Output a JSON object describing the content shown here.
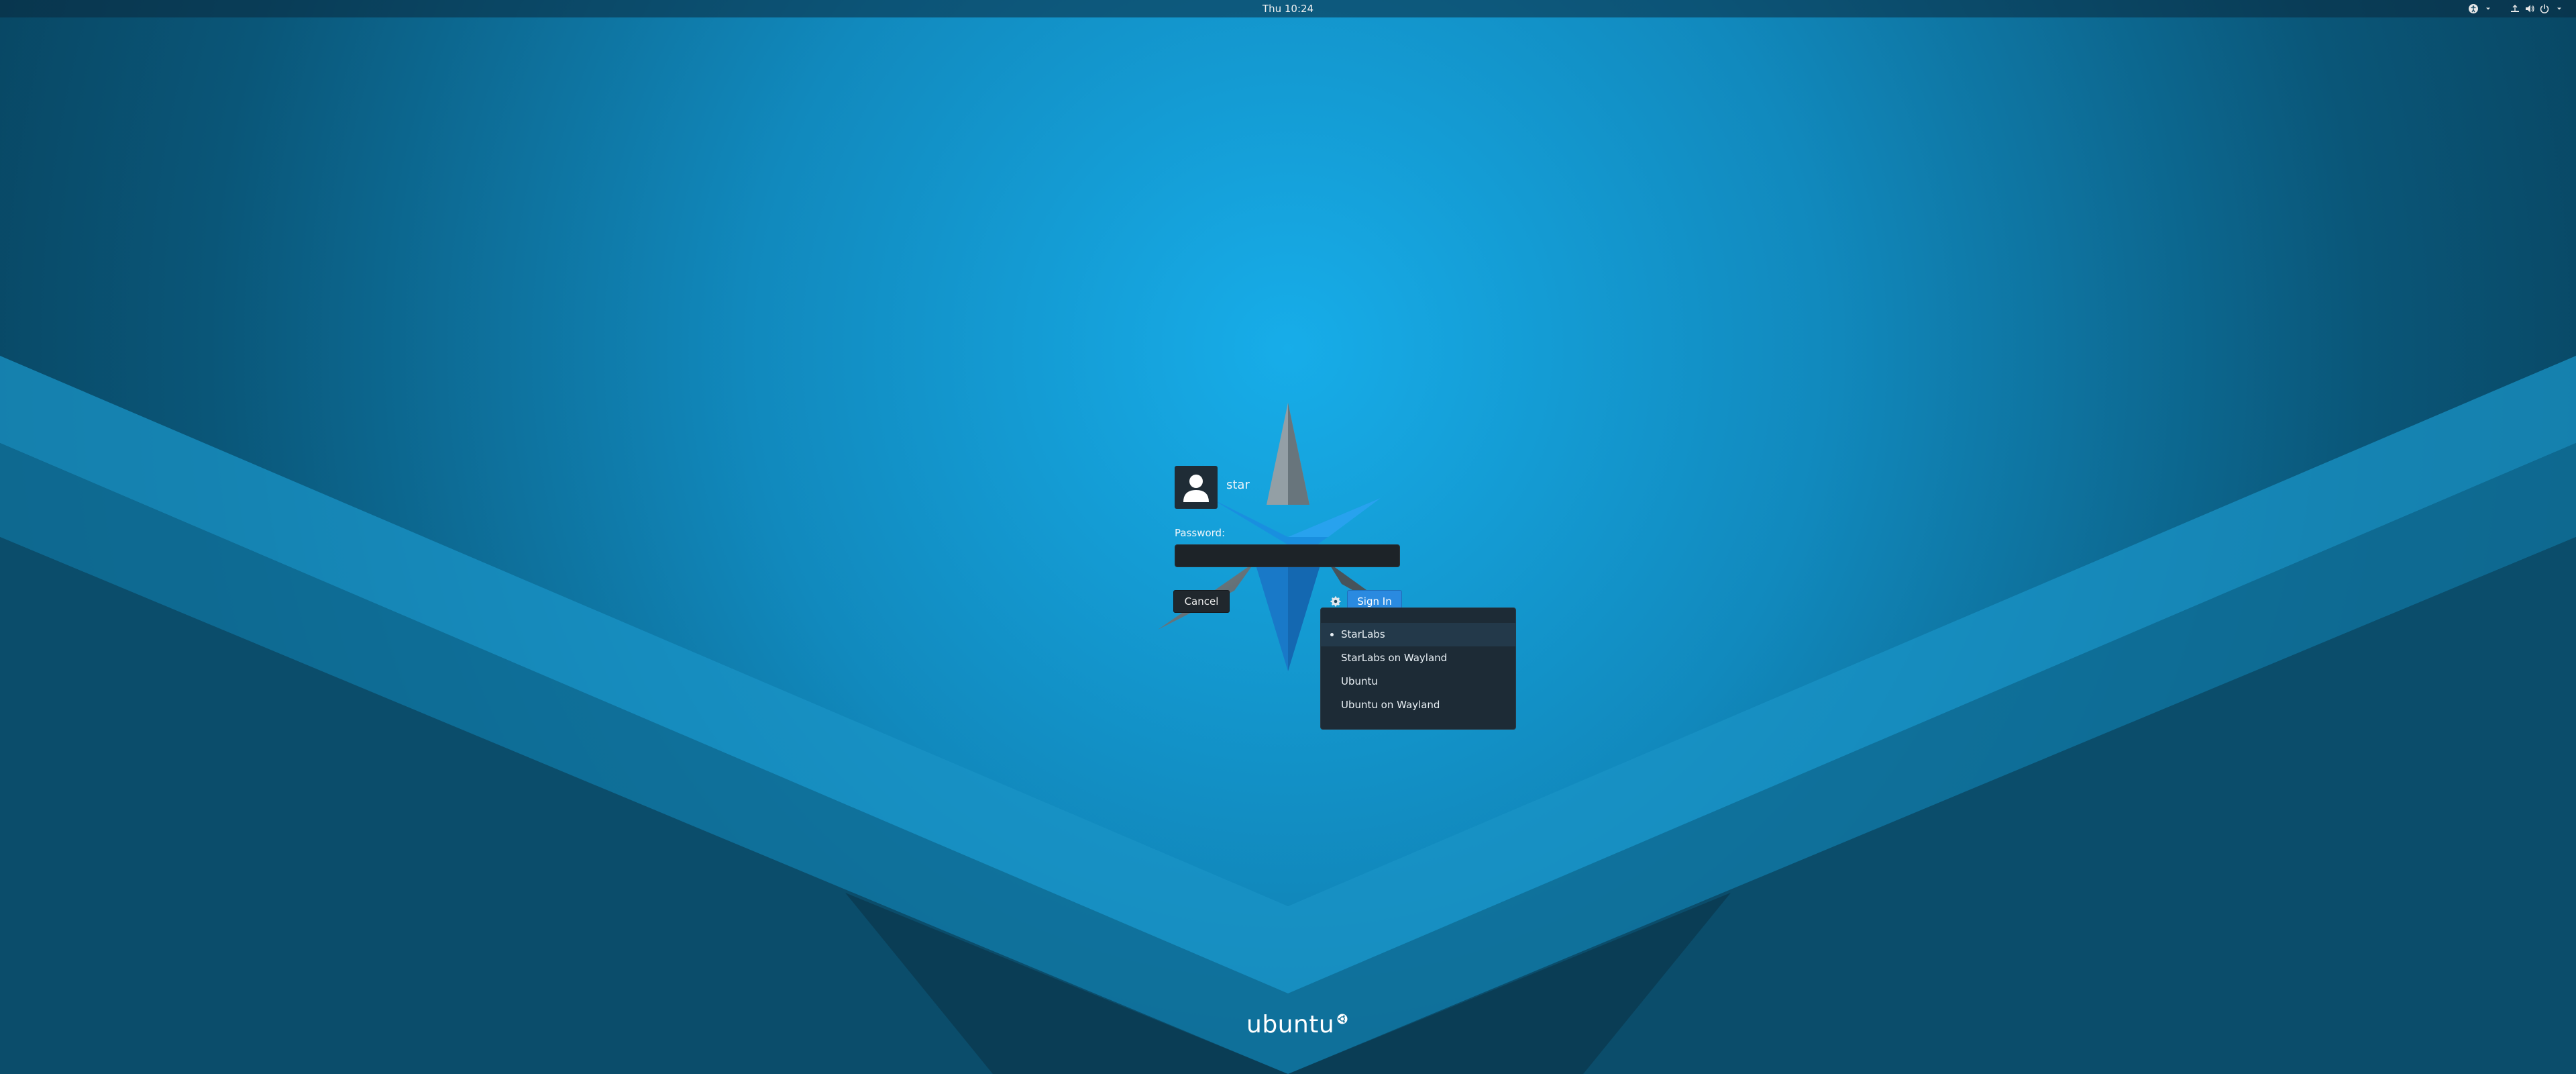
{
  "topbar": {
    "clock": "Thu 10:24",
    "icons": [
      "accessibility-icon",
      "network-icon",
      "volume-icon",
      "power-icon",
      "menu-arrow-icon"
    ]
  },
  "login": {
    "username": "star",
    "password_label": "Password:",
    "password_value": "",
    "cancel_label": "Cancel",
    "signin_label": "Sign In"
  },
  "session_menu": {
    "items": [
      {
        "label": "StarLabs",
        "selected": true
      },
      {
        "label": "StarLabs on Wayland",
        "selected": false
      },
      {
        "label": "Ubuntu",
        "selected": false
      },
      {
        "label": "Ubuntu on Wayland",
        "selected": false
      }
    ]
  },
  "branding": {
    "wordmark": "ubuntu"
  },
  "colors": {
    "accent": "#2a8ae0",
    "background_center": "#16aae6",
    "background_edge": "#0a4a66"
  }
}
